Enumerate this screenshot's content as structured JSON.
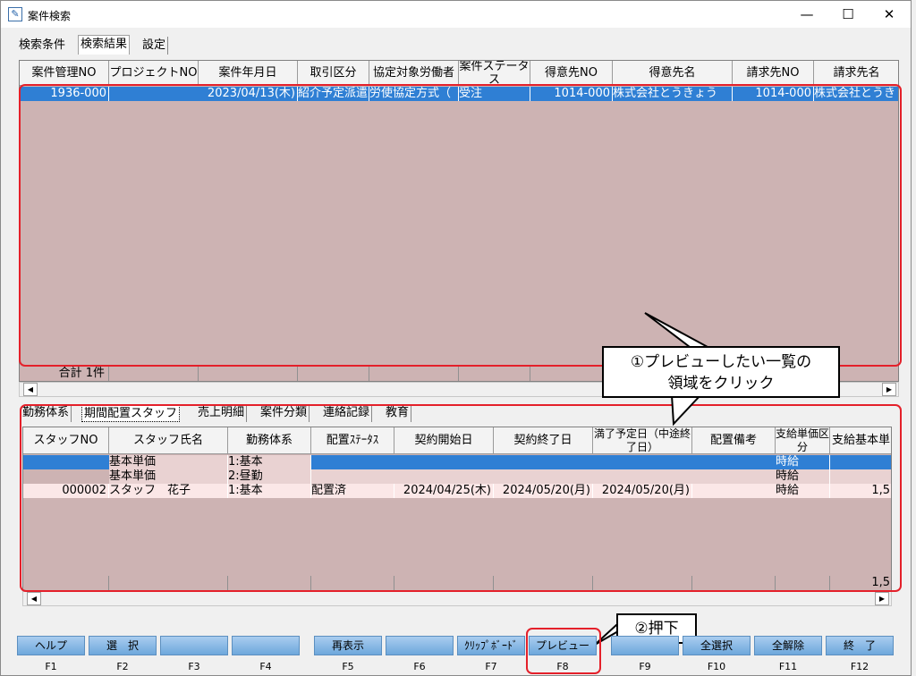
{
  "window": {
    "title": "案件検索",
    "minimize": "—",
    "maximize": "☐",
    "close": "✕"
  },
  "top_tabs": [
    "検索条件",
    "検索結果",
    "設定"
  ],
  "results": {
    "headers": [
      "案件管理NO",
      "プロジェクトNO",
      "案件年月日",
      "取引区分",
      "協定対象労働者",
      "案件ステータス",
      "得意先NO",
      "得意先名",
      "請求先NO",
      "請求先名"
    ],
    "row": [
      "1936-000",
      "",
      "2023/04/13(木)",
      "紹介予定派遣",
      "労使協定方式（",
      "受注",
      "1014-000",
      "株式会社とうきょう",
      "1014-000",
      "株式会社とうき"
    ],
    "summary": "合計 1件"
  },
  "bottom_tabs": [
    "勤務体系",
    "期間配置スタッフ",
    "売上明細",
    "案件分類",
    "連絡記録",
    "教育"
  ],
  "staff": {
    "headers": [
      "スタッフNO",
      "スタッフ氏名",
      "勤務体系",
      "配置ｽﾃｰﾀｽ",
      "契約開始日",
      "契約終了日",
      "満了予定日（中途終了日）",
      "配置備考",
      "支給単価区分",
      "支給基本単"
    ],
    "rows": [
      [
        "",
        "基本単価",
        "1:基本",
        "",
        "",
        "",
        "",
        "",
        "時給",
        ""
      ],
      [
        "",
        "基本単価",
        "2:昼勤",
        "",
        "",
        "",
        "",
        "",
        "時給",
        ""
      ],
      [
        "000002",
        "スタッフ　花子",
        "1:基本",
        "配置済",
        "2024/04/25(木)",
        "2024/05/20(月)",
        "2024/05/20(月)",
        "",
        "時給",
        "1,5"
      ]
    ],
    "summary_last": "1,5"
  },
  "fkeys": [
    {
      "label": "ヘルプ",
      "key": "F1"
    },
    {
      "label": "選　択",
      "key": "F2"
    },
    {
      "label": "",
      "key": "F3"
    },
    {
      "label": "",
      "key": "F4"
    },
    {
      "label": "再表示",
      "key": "F5"
    },
    {
      "label": "",
      "key": "F6"
    },
    {
      "label": "ｸﾘｯﾌﾟﾎﾞｰﾄﾞ",
      "key": "F7"
    },
    {
      "label": "プレビュー",
      "key": "F8"
    },
    {
      "label": "",
      "key": "F9"
    },
    {
      "label": "全選択",
      "key": "F10"
    },
    {
      "label": "全解除",
      "key": "F11"
    },
    {
      "label": "終　了",
      "key": "F12"
    }
  ],
  "callouts": {
    "c1_line1": "①プレビューしたい一覧の",
    "c1_line2": "領域をクリック",
    "c2": "②押下"
  },
  "colors": {
    "selected": "#2f7fd4",
    "grid": "#cdb3b3",
    "highlight": "#e4202a"
  }
}
